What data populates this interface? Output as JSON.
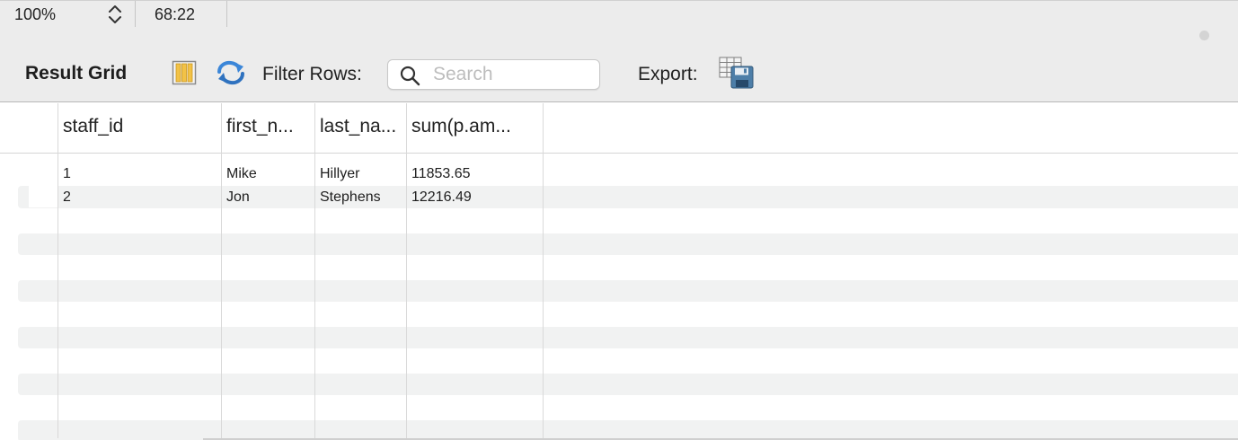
{
  "status": {
    "zoom": "100%",
    "cursor_position": "68:22"
  },
  "toolbar": {
    "result_grid_label": "Result Grid",
    "filter_label": "Filter Rows:",
    "search_placeholder": "Search",
    "search_value": "",
    "export_label": "Export:"
  },
  "grid": {
    "columns": [
      "staff_id",
      "first_n...",
      "last_na...",
      "sum(p.am..."
    ],
    "rows": [
      [
        "1",
        "Mike",
        "Hillyer",
        "11853.65"
      ],
      [
        "2",
        "Jon",
        "Stephens",
        "12216.49"
      ]
    ]
  },
  "icons": {
    "stepper": "chevron-up-down-icon",
    "columns": "columns-icon",
    "refresh": "refresh-icon",
    "search": "search-icon",
    "export": "export-save-icon"
  },
  "colors": {
    "toolbar_bg": "#ececec",
    "stripe_bg": "#f1f2f2",
    "refresh_blue": "#3b86d8"
  }
}
